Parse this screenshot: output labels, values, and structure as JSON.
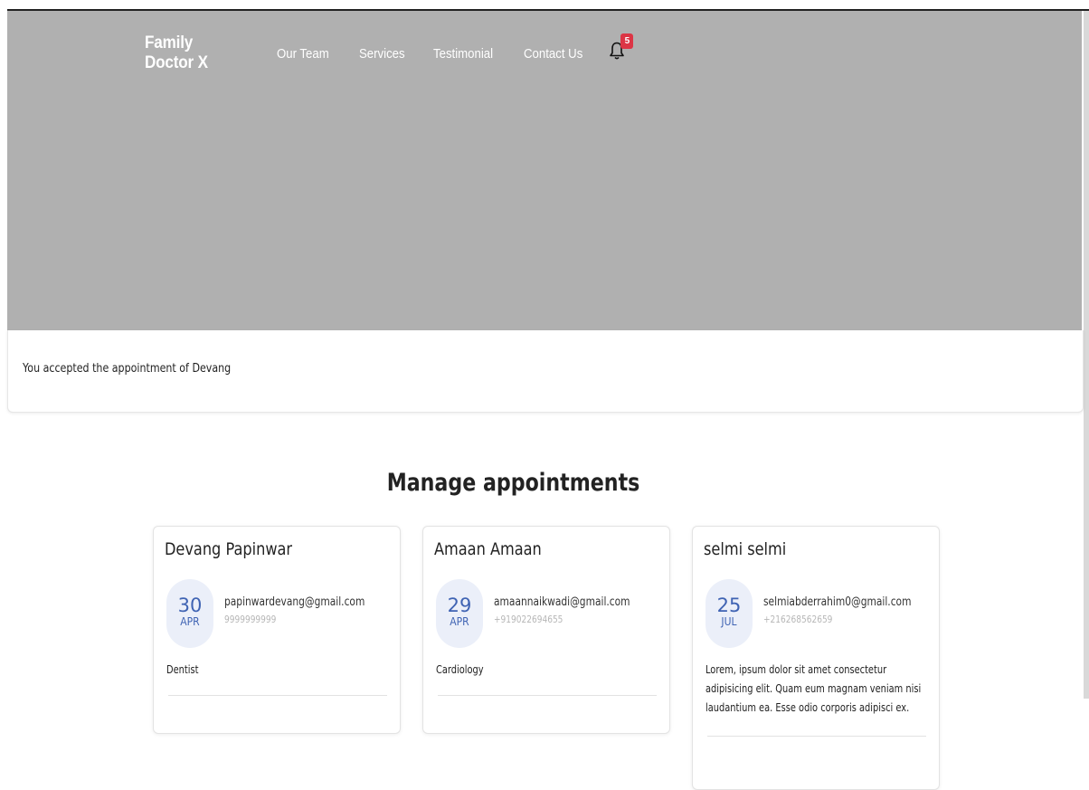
{
  "nav": {
    "brand": "Family Doctor X",
    "links": [
      "Our Team",
      "Services",
      "Testimonial",
      "Contact Us"
    ],
    "notification_count": "5",
    "bell_icon": "bell-icon"
  },
  "alert": {
    "message": "You accepted the appointment of Devang"
  },
  "section": {
    "title": "Manage appointments"
  },
  "appointments": [
    {
      "name": "Devang Papinwar",
      "day": "30",
      "month": "APR",
      "email": "papinwardevang@gmail.com",
      "phone": "9999999999",
      "description": "Dentist"
    },
    {
      "name": "Amaan Amaan",
      "day": "29",
      "month": "APR",
      "email": "amaannaikwadi@gmail.com",
      "phone": "+919022694655",
      "description": "Cardiology"
    },
    {
      "name": "selmi selmi",
      "day": "25",
      "month": "JUL",
      "email": "selmiabderrahim0@gmail.com",
      "phone": "+216268562659",
      "description": "Lorem, ipsum dolor sit amet consectetur adipisicing elit. Quam eum magnam veniam nisi laudantium ea. Esse odio corporis adipisci ex."
    }
  ],
  "colors": {
    "hero_bg": "#b0b0b0",
    "accent": "#3f63b3",
    "date_bg": "#ebeff9",
    "badge": "#dc3545"
  }
}
